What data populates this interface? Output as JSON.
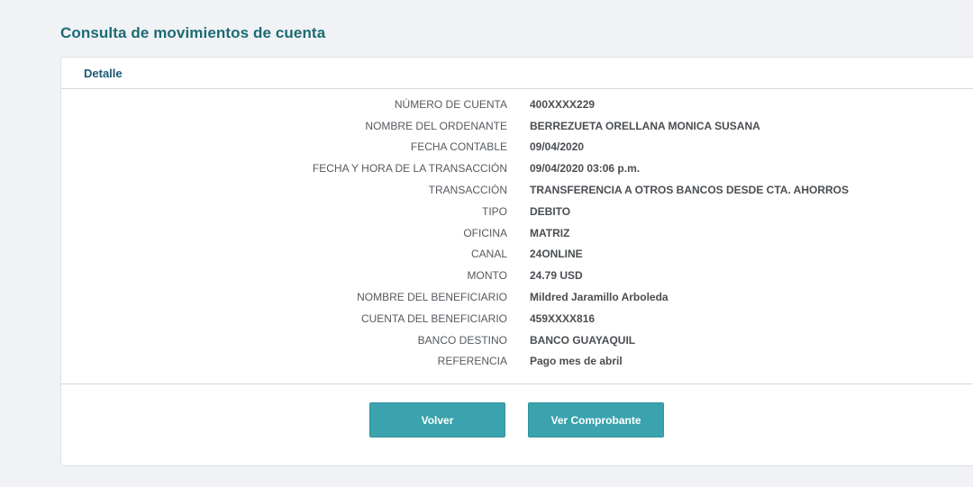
{
  "page": {
    "title": "Consulta de movimientos de cuenta"
  },
  "card": {
    "header_title": "Detalle"
  },
  "details": [
    {
      "label": "NÚMERO DE CUENTA",
      "value": "400XXXX229"
    },
    {
      "label": "NOMBRE DEL ORDENANTE",
      "value": "BERREZUETA ORELLANA MONICA SUSANA"
    },
    {
      "label": "FECHA CONTABLE",
      "value": "09/04/2020"
    },
    {
      "label": "FECHA Y HORA DE LA TRANSACCIÓN",
      "value": "09/04/2020 03:06 p.m."
    },
    {
      "label": "TRANSACCIÓN",
      "value": "TRANSFERENCIA A OTROS BANCOS DESDE CTA. AHORROS"
    },
    {
      "label": "TIPO",
      "value": "DEBITO"
    },
    {
      "label": "OFICINA",
      "value": "MATRIZ"
    },
    {
      "label": "CANAL",
      "value": "24ONLINE"
    },
    {
      "label": "MONTO",
      "value": "24.79 USD"
    },
    {
      "label": "NOMBRE DEL BENEFICIARIO",
      "value": "Mildred Jaramillo Arboleda"
    },
    {
      "label": "CUENTA DEL BENEFICIARIO",
      "value": "459XXXX816"
    },
    {
      "label": "BANCO DESTINO",
      "value": "BANCO GUAYAQUIL"
    },
    {
      "label": "REFERENCIA",
      "value": "Pago mes de abril"
    }
  ],
  "actions": {
    "back_label": "Volver",
    "receipt_label": "Ver Comprobante"
  },
  "colors": {
    "title": "#1c6b73",
    "button": "#3aa3ad",
    "background": "#f0f2f5"
  }
}
